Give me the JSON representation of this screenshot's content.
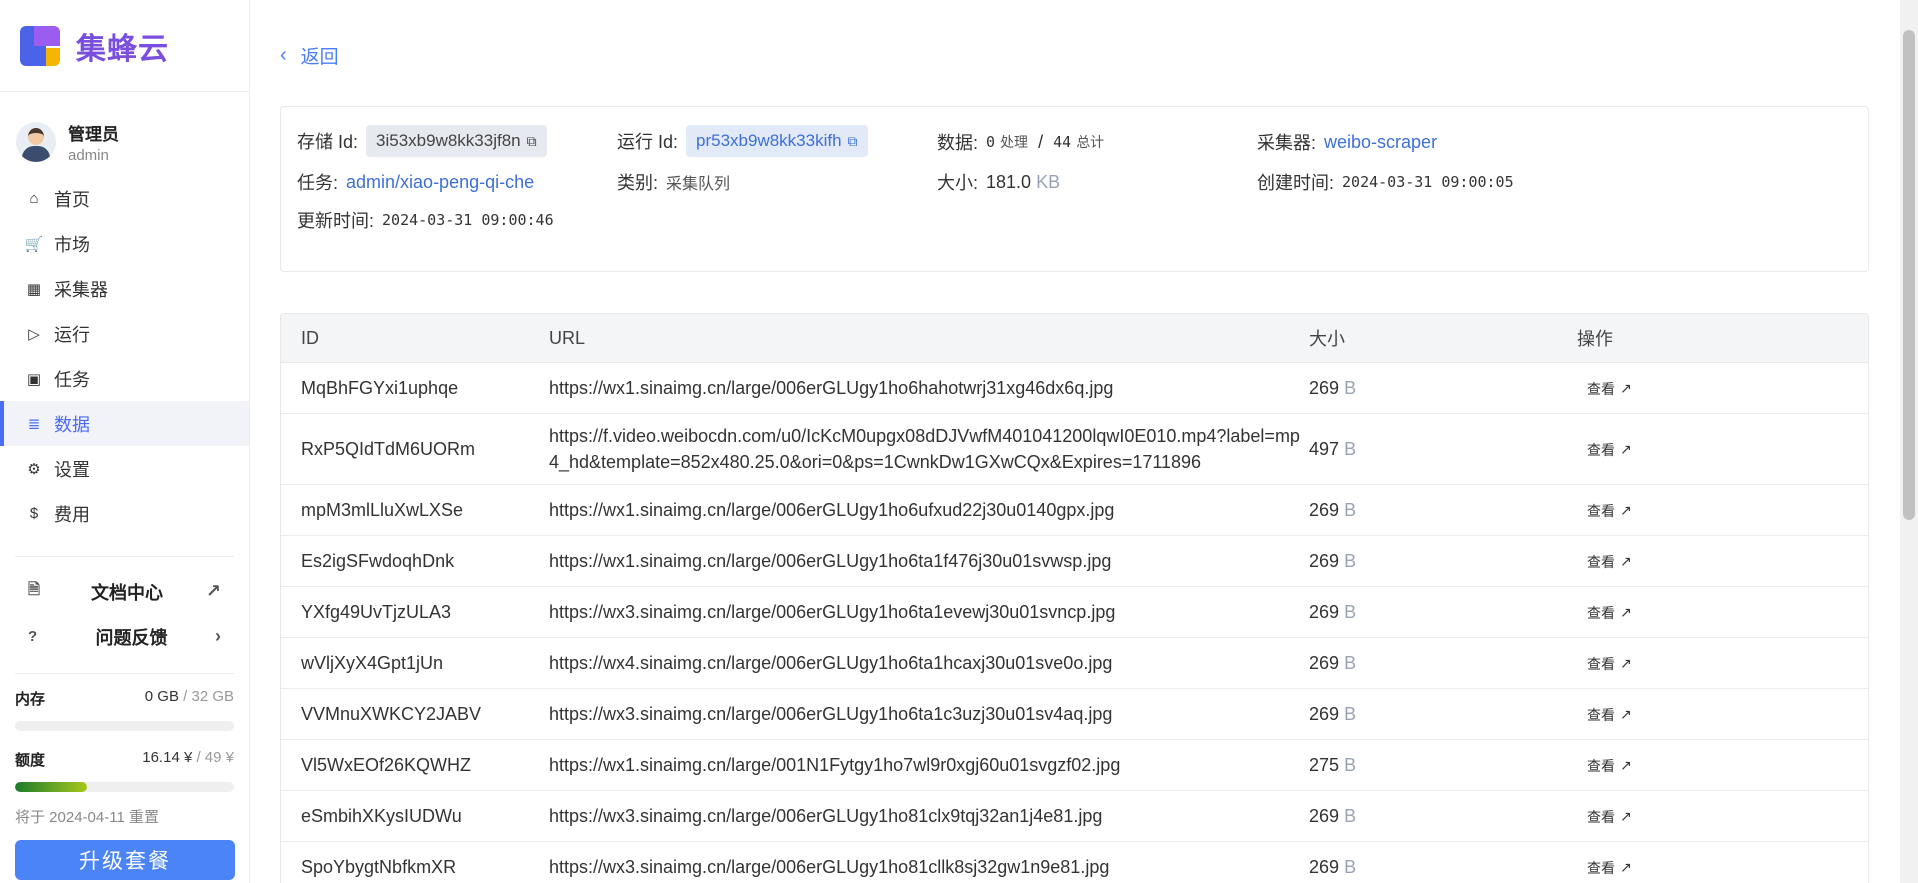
{
  "brand": {
    "name": "集蜂云"
  },
  "user": {
    "title": "管理员",
    "name": "admin"
  },
  "nav": [
    {
      "icon": "home-icon",
      "glyph": "⌂",
      "label": "首页"
    },
    {
      "icon": "cart-icon",
      "glyph": "🛒",
      "label": "市场"
    },
    {
      "icon": "grid-icon",
      "glyph": "▦",
      "label": "采集器"
    },
    {
      "icon": "run-icon",
      "glyph": "▷",
      "label": "运行"
    },
    {
      "icon": "calendar-icon",
      "glyph": "▣",
      "label": "任务"
    },
    {
      "icon": "list-icon",
      "glyph": "≣",
      "label": "数据",
      "active": true
    },
    {
      "icon": "gear-icon",
      "glyph": "⚙",
      "label": "设置"
    },
    {
      "icon": "dollar-icon",
      "glyph": "$",
      "label": "费用"
    }
  ],
  "docs": {
    "label": "文档中心",
    "feedback": "问题反馈"
  },
  "resources": {
    "memory_label": "内存",
    "memory_used": "0 GB",
    "memory_total": "/ 32 GB",
    "memory_fraction": 0,
    "quota_label": "额度",
    "quota_used": "16.14 ¥",
    "quota_total": "/ 49 ¥",
    "quota_fraction": 0.33,
    "reset": "将于 2024-04-11 重置"
  },
  "upgrade_label": "升级套餐",
  "back_label": "返回",
  "info": {
    "storage_label": "存储 Id:",
    "storage_id": "3i53xb9w8kk33jf8n",
    "run_label": "运行 Id:",
    "run_id": "pr53xb9w8kk33kifh",
    "data_label": "数据:",
    "processed": "0",
    "processed_unit": "处理",
    "total": "44",
    "total_unit": "总计",
    "slash": "/",
    "collector_label": "采集器:",
    "collector": "weibo-scraper",
    "task_label": "任务:",
    "task": "admin/xiao-peng-qi-che",
    "type_label": "类别:",
    "type": "采集队列",
    "size_label": "大小:",
    "size": "181.0",
    "size_unit": "KB",
    "created_label": "创建时间:",
    "created": "2024-03-31 09:00:05",
    "updated_label": "更新时间:",
    "updated": "2024-03-31 09:00:46"
  },
  "table": {
    "headers": {
      "id": "ID",
      "url": "URL",
      "size": "大小",
      "op": "操作"
    },
    "view_label": "查看",
    "rows": [
      {
        "id": "MqBhFGYxi1uphqe",
        "url": "https://wx1.sinaimg.cn/large/006erGLUgy1ho6hahotwrj31xg46dx6q.jpg",
        "size": "269",
        "unit": "B"
      },
      {
        "id": "RxP5QIdTdM6UORm",
        "url": "https://f.video.weibocdn.com/u0/IcKcM0upgx08dDJVwfM401041200lqwI0E010.mp4?label=mp4_hd&template=852x480.25.0&ori=0&ps=1CwnkDw1GXwCQx&Expires=1711896",
        "size": "497",
        "unit": "B",
        "tall": true
      },
      {
        "id": "mpM3mlLluXwLXSe",
        "url": "https://wx1.sinaimg.cn/large/006erGLUgy1ho6ufxud22j30u0140gpx.jpg",
        "size": "269",
        "unit": "B"
      },
      {
        "id": "Es2igSFwdoqhDnk",
        "url": "https://wx1.sinaimg.cn/large/006erGLUgy1ho6ta1f476j30u01svwsp.jpg",
        "size": "269",
        "unit": "B"
      },
      {
        "id": "YXfg49UvTjzULA3",
        "url": "https://wx3.sinaimg.cn/large/006erGLUgy1ho6ta1evewj30u01svncp.jpg",
        "size": "269",
        "unit": "B"
      },
      {
        "id": "wVljXyX4Gpt1jUn",
        "url": "https://wx4.sinaimg.cn/large/006erGLUgy1ho6ta1hcaxj30u01sve0o.jpg",
        "size": "269",
        "unit": "B"
      },
      {
        "id": "VVMnuXWKCY2JABV",
        "url": "https://wx3.sinaimg.cn/large/006erGLUgy1ho6ta1c3uzj30u01sv4aq.jpg",
        "size": "269",
        "unit": "B"
      },
      {
        "id": "Vl5WxEOf26KQWHZ",
        "url": "https://wx1.sinaimg.cn/large/001N1Fytgy1ho7wl9r0xgj60u01svgzf02.jpg",
        "size": "275",
        "unit": "B"
      },
      {
        "id": "eSmbihXKysIUDWu",
        "url": "https://wx3.sinaimg.cn/large/006erGLUgy1ho81clx9tqj32an1j4e81.jpg",
        "size": "269",
        "unit": "B"
      },
      {
        "id": "SpoYbygtNbfkmXR",
        "url": "https://wx3.sinaimg.cn/large/006erGLUgy1ho81cllk8sj32gw1n9e81.jpg",
        "size": "269",
        "unit": "B"
      }
    ]
  }
}
